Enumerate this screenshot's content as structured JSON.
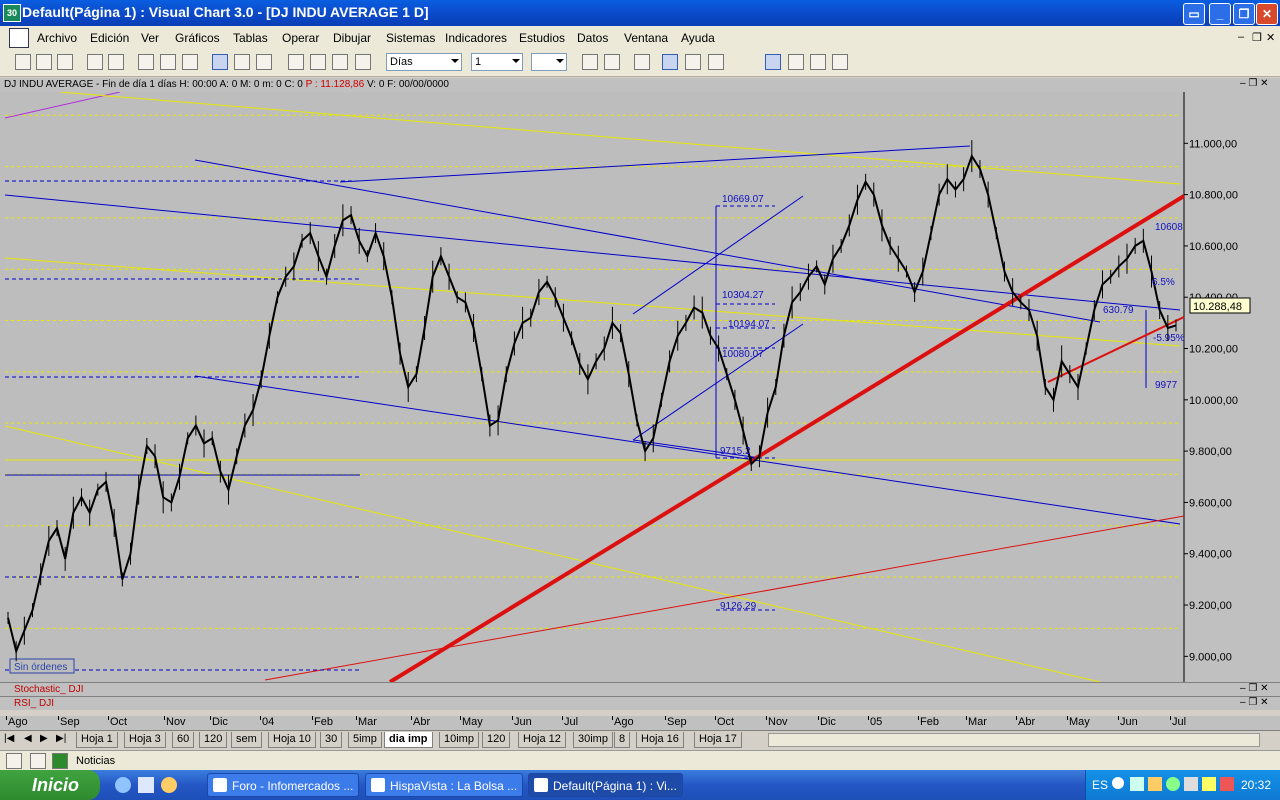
{
  "window": {
    "title": "Default(Página 1) : Visual Chart  3.0 - [DJ INDU AVERAGE 1 D]",
    "app_icon": "30"
  },
  "menu": [
    "Archivo",
    "Edición",
    "Ver",
    "Gráficos",
    "Tablas",
    "Operar",
    "Dibujar",
    "Sistemas",
    "Indicadores",
    "Estudios",
    "Datos",
    "Ventana",
    "Ayuda"
  ],
  "toolbar": {
    "period": "Días",
    "multiplier": "1"
  },
  "info": {
    "prefix": "DJ INDU AVERAGE - Fin de día 1 días H: 00:00  A: 0  M: 0  m: 0  C: 0 ",
    "price": " P : 11.128,86 ",
    "suffix": " V: 0  F: 00/00/0000"
  },
  "chart_data": {
    "type": "line",
    "title": "DJ INDU AVERAGE 1 D",
    "ylim": [
      8900,
      11200
    ],
    "y_ticks": [
      "11.000,00",
      "10.800,00",
      "10.600,00",
      "10.400,00",
      "10.200,00",
      "10.000,00",
      "9.800,00",
      "9.600,00",
      "9.400,00",
      "9.200,00",
      "9.000,00"
    ],
    "y_tick_values": [
      11000,
      10800,
      10600,
      10400,
      10200,
      10000,
      9800,
      9600,
      9400,
      9200,
      9000
    ],
    "x_labels": [
      "Ago",
      "Sep",
      "Oct",
      "Nov",
      "Dic",
      "04",
      "Feb",
      "Mar",
      "Abr",
      "May",
      "Jun",
      "Jul",
      "Ago",
      "Sep",
      "Oct",
      "Nov",
      "Dic",
      "05",
      "Feb",
      "Mar",
      "Abr",
      "May",
      "Jun",
      "Jul"
    ],
    "last_price": "10.288,48",
    "series": [
      {
        "values": [
          9150,
          9020,
          9100,
          9180,
          9320,
          9450,
          9500,
          9380,
          9560,
          9620,
          9560,
          9650,
          9680,
          9520,
          9300,
          9400,
          9650,
          9820,
          9780,
          9620,
          9600,
          9700,
          9850,
          9900,
          9830,
          9850,
          9720,
          9650,
          9780,
          9900,
          9960,
          10080,
          10250,
          10400,
          10480,
          10520,
          10620,
          10650,
          10560,
          10480,
          10600,
          10700,
          10720,
          10620,
          10560,
          10650,
          10560,
          10400,
          10180,
          10050,
          10100,
          10280,
          10480,
          10560,
          10480,
          10400,
          10380,
          10280,
          10100,
          9900,
          9920,
          10100,
          10220,
          10300,
          10320,
          10420,
          10460,
          10400,
          10320,
          10240,
          10140,
          10080,
          10150,
          10200,
          10300,
          10260,
          10100,
          9920,
          9800,
          9850,
          10000,
          10150,
          10250,
          10300,
          10360,
          10340,
          10250,
          10200,
          10100,
          10000,
          9880,
          9750,
          9780,
          9950,
          10050,
          10250,
          10380,
          10420,
          10480,
          10520,
          10450,
          10550,
          10600,
          10680,
          10780,
          10850,
          10800,
          10680,
          10600,
          10550,
          10500,
          10420,
          10500,
          10650,
          10800,
          10860,
          10820,
          10860,
          10950,
          10900,
          10800,
          10650,
          10500,
          10420,
          10380,
          10350,
          10250,
          10050,
          10000,
          10150,
          10100,
          10050,
          10200,
          10350,
          10450,
          10480,
          10520,
          10550,
          10600,
          10620,
          10500,
          10350,
          10280,
          10290
        ]
      }
    ],
    "annotations": [
      "10669.07",
      "10304.27",
      "10194.07",
      "10080.07",
      "9715.2",
      "9126.29",
      "10608",
      "630.79",
      "-5.95%",
      "9977",
      "6.5%"
    ]
  },
  "panels": {
    "stochastic": "Stochastic_ DJI",
    "rsi": "RSI_ DJI"
  },
  "orders_label": "Sin órdenes",
  "sheet_tabs": [
    "Hoja 1",
    "Hoja 3",
    "60",
    "120",
    "sem",
    "Hoja 10",
    "30",
    "5imp",
    "dia imp",
    "10imp",
    "120",
    "Hoja 12",
    "30imp",
    "8",
    "Hoja 16",
    "Hoja 17"
  ],
  "active_tab": "dia imp",
  "noticias": "Noticias",
  "taskbar": {
    "start": "Inicio",
    "tasks": [
      "Foro - Infomercados ...",
      "HispaVista : La Bolsa ...",
      "Default(Página 1) : Vi..."
    ],
    "lang": "ES",
    "clock": "20:32"
  },
  "colors": {
    "chart_bg": "#bdbdbd",
    "candle": "#000000",
    "trend_blue": "#0000cc",
    "trend_red": "#dd1010",
    "yellow": "#e8e800",
    "titlebar": "#0b47c6"
  }
}
